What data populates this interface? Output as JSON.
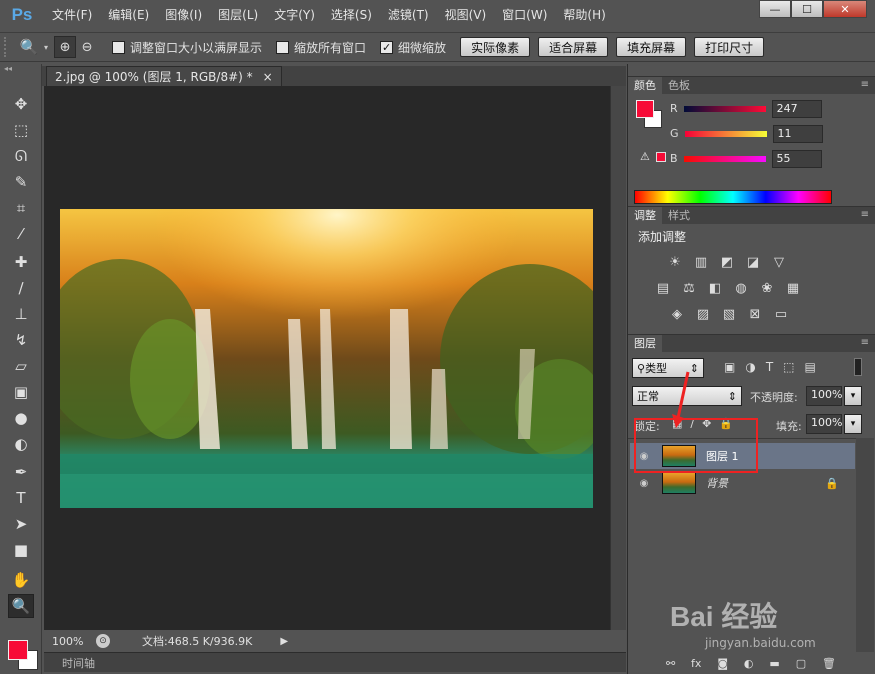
{
  "app": {
    "logo": "Ps"
  },
  "menu": [
    "文件(F)",
    "编辑(E)",
    "图像(I)",
    "图层(L)",
    "文字(Y)",
    "选择(S)",
    "滤镜(T)",
    "视图(V)",
    "窗口(W)",
    "帮助(H)"
  ],
  "window_buttons": {
    "minimize": "—",
    "restore": "☐",
    "close": "✕"
  },
  "options": {
    "resize_windows_label": "调整窗口大小以满屏显示",
    "zoom_all_label": "缩放所有窗口",
    "scrubby_zoom_label": "细微缩放",
    "actual_pixels": "实际像素",
    "fit_screen": "适合屏幕",
    "fill_screen": "填充屏幕",
    "print_size": "打印尺寸"
  },
  "document": {
    "tab_title": "2.jpg @ 100% (图层 1, RGB/8#) *",
    "close": "×"
  },
  "status": {
    "zoom": "100%",
    "doc_info": "文档:468.5 K/936.9K"
  },
  "timeline_label": "时间轴",
  "panels": {
    "color_tab": "颜色",
    "swatches_tab": "色板",
    "adjust_tab": "调整",
    "styles_tab": "样式",
    "layers_tab": "图层",
    "add_adjustment": "添加调整"
  },
  "color": {
    "r_label": "R",
    "r_value": "247",
    "g_label": "G",
    "g_value": "11",
    "b_label": "B",
    "b_value": "55",
    "foreground": "#f70b37"
  },
  "layers": {
    "filter_kind": "类型",
    "blend_mode": "正常",
    "opacity_label": "不透明度:",
    "opacity_value": "100%",
    "lock_label": "锁定:",
    "fill_label": "填充:",
    "fill_value": "100%",
    "items": [
      {
        "name": "图层 1",
        "selected": true
      },
      {
        "name": "背景",
        "locked": true
      }
    ]
  },
  "watermark": {
    "text": "Bai 经验",
    "url": "jingyan.baidu.com"
  }
}
